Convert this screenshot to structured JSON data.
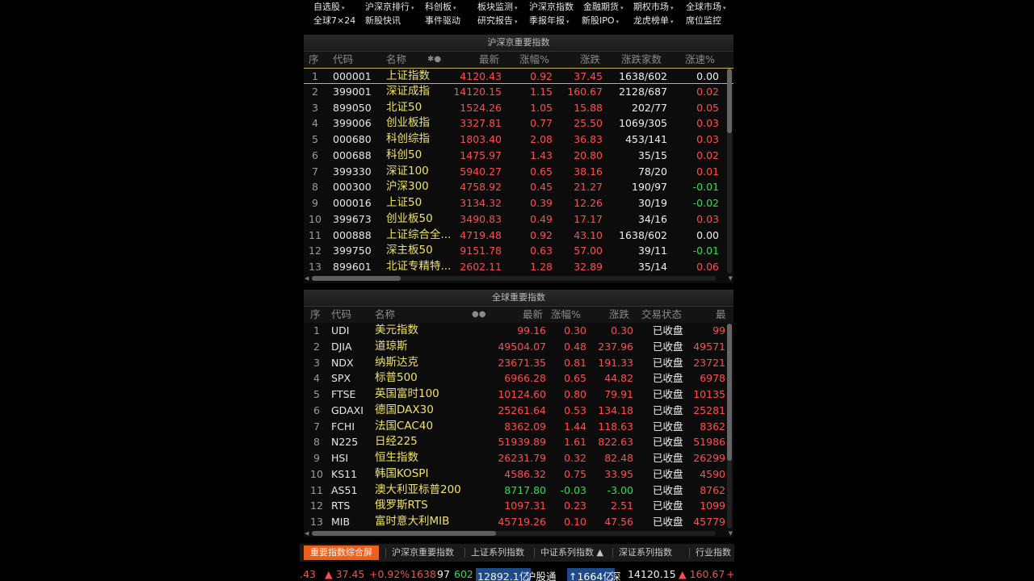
{
  "menu": {
    "row1": [
      {
        "label": "自选股",
        "dd": true
      },
      {
        "label": "沪深京排行",
        "dd": true
      },
      {
        "label": "科创板",
        "dd": true
      },
      {
        "label": "板块监测",
        "dd": true
      },
      {
        "label": "沪深京指数",
        "dd": false
      },
      {
        "label": "金融期货",
        "dd": true
      },
      {
        "label": "期权市场",
        "dd": true
      },
      {
        "label": "全球市场",
        "dd": true
      }
    ],
    "row2": [
      {
        "label": "全球7×24",
        "dd": false
      },
      {
        "label": "新股快讯",
        "dd": false
      },
      {
        "label": "事件驱动",
        "dd": false
      },
      {
        "label": "研究报告",
        "dd": true
      },
      {
        "label": "季报年报",
        "dd": true
      },
      {
        "label": "新股IPO",
        "dd": true
      },
      {
        "label": "龙虎榜单",
        "dd": true
      },
      {
        "label": "席位监控",
        "dd": false
      }
    ]
  },
  "domestic": {
    "title": "沪深京重要指数",
    "headers": {
      "idx": "序",
      "code": "代码",
      "name": "名称",
      "dots": "✱●",
      "last": "最新",
      "pct": "涨幅%",
      "chg": "涨跌",
      "adv": "涨跌家数",
      "speed": "涨速%"
    },
    "rows": [
      {
        "idx": "1",
        "code": "000001",
        "name": "上证指数",
        "last": "4120.43",
        "pct": "0.92",
        "chg": "37.45",
        "adv": "1638/602",
        "speed": "0.00",
        "sc": "white"
      },
      {
        "idx": "2",
        "code": "399001",
        "name": "深证成指",
        "last": "14120.15",
        "pct": "1.15",
        "chg": "160.67",
        "adv": "2128/687",
        "speed": "0.02",
        "sc": "red"
      },
      {
        "idx": "3",
        "code": "899050",
        "name": "北证50",
        "last": "1524.26",
        "pct": "1.05",
        "chg": "15.88",
        "adv": "202/77",
        "speed": "0.05",
        "sc": "red"
      },
      {
        "idx": "4",
        "code": "399006",
        "name": "创业板指",
        "last": "3327.81",
        "pct": "0.77",
        "chg": "25.50",
        "adv": "1069/305",
        "speed": "0.03",
        "sc": "red"
      },
      {
        "idx": "5",
        "code": "000680",
        "name": "科创综指",
        "last": "1803.40",
        "pct": "2.08",
        "chg": "36.83",
        "adv": "453/141",
        "speed": "0.03",
        "sc": "red"
      },
      {
        "idx": "6",
        "code": "000688",
        "name": "科创50",
        "last": "1475.97",
        "pct": "1.43",
        "chg": "20.80",
        "adv": "35/15",
        "speed": "0.02",
        "sc": "red"
      },
      {
        "idx": "7",
        "code": "399330",
        "name": "深证100",
        "last": "5940.27",
        "pct": "0.65",
        "chg": "38.16",
        "adv": "78/20",
        "speed": "0.01",
        "sc": "red"
      },
      {
        "idx": "8",
        "code": "000300",
        "name": "沪深300",
        "last": "4758.92",
        "pct": "0.45",
        "chg": "21.27",
        "adv": "190/97",
        "speed": "-0.01",
        "sc": "green"
      },
      {
        "idx": "9",
        "code": "000016",
        "name": "上证50",
        "last": "3134.32",
        "pct": "0.39",
        "chg": "12.26",
        "adv": "30/19",
        "speed": "-0.02",
        "sc": "green"
      },
      {
        "idx": "10",
        "code": "399673",
        "name": "创业板50",
        "last": "3490.83",
        "pct": "0.49",
        "chg": "17.17",
        "adv": "34/16",
        "speed": "0.03",
        "sc": "red"
      },
      {
        "idx": "11",
        "code": "000888",
        "name": "上证综合全...",
        "last": "4719.48",
        "pct": "0.92",
        "chg": "43.10",
        "adv": "1638/602",
        "speed": "0.00",
        "sc": "white"
      },
      {
        "idx": "12",
        "code": "399750",
        "name": "深主板50",
        "last": "9151.78",
        "pct": "0.63",
        "chg": "57.00",
        "adv": "39/11",
        "speed": "-0.01",
        "sc": "green"
      },
      {
        "idx": "13",
        "code": "899601",
        "name": "北证专精特...",
        "last": "2602.11",
        "pct": "1.28",
        "chg": "32.89",
        "adv": "35/14",
        "speed": "0.06",
        "sc": "red"
      }
    ]
  },
  "global": {
    "title": "全球重要指数",
    "headers": {
      "idx": "序",
      "code": "代码",
      "name": "名称",
      "dots": "●●",
      "last": "最新",
      "pct": "涨幅%",
      "chg": "涨跌",
      "status": "交易状态",
      "extra": "最"
    },
    "rows": [
      {
        "idx": "1",
        "code": "UDI",
        "name": "美元指数",
        "last": "99.16",
        "pct": "0.30",
        "chg": "0.30",
        "status": "已收盘",
        "extra": "99",
        "c": "red"
      },
      {
        "idx": "2",
        "code": "DJIA",
        "name": "道琼斯",
        "last": "49504.07",
        "pct": "0.48",
        "chg": "237.96",
        "status": "已收盘",
        "extra": "49571",
        "c": "red"
      },
      {
        "idx": "3",
        "code": "NDX",
        "name": "纳斯达克",
        "last": "23671.35",
        "pct": "0.81",
        "chg": "191.33",
        "status": "已收盘",
        "extra": "23721",
        "c": "red"
      },
      {
        "idx": "4",
        "code": "SPX",
        "name": "标普500",
        "last": "6966.28",
        "pct": "0.65",
        "chg": "44.82",
        "status": "已收盘",
        "extra": "6978",
        "c": "red"
      },
      {
        "idx": "5",
        "code": "FTSE",
        "name": "英国富时100",
        "last": "10124.60",
        "pct": "0.80",
        "chg": "79.91",
        "status": "已收盘",
        "extra": "10135",
        "c": "red"
      },
      {
        "idx": "6",
        "code": "GDAXI",
        "name": "德国DAX30",
        "last": "25261.64",
        "pct": "0.53",
        "chg": "134.18",
        "status": "已收盘",
        "extra": "25281",
        "c": "red"
      },
      {
        "idx": "7",
        "code": "FCHI",
        "name": "法国CAC40",
        "last": "8362.09",
        "pct": "1.44",
        "chg": "118.63",
        "status": "已收盘",
        "extra": "8362",
        "c": "red"
      },
      {
        "idx": "8",
        "code": "N225",
        "name": "日经225",
        "last": "51939.89",
        "pct": "1.61",
        "chg": "822.63",
        "status": "已收盘",
        "extra": "51986",
        "c": "red"
      },
      {
        "idx": "9",
        "code": "HSI",
        "name": "恒生指数",
        "last": "26231.79",
        "pct": "0.32",
        "chg": "82.48",
        "status": "已收盘",
        "extra": "26299",
        "c": "red"
      },
      {
        "idx": "10",
        "code": "KS11",
        "name": "韩国KOSPI",
        "last": "4586.32",
        "pct": "0.75",
        "chg": "33.95",
        "status": "已收盘",
        "extra": "4590",
        "c": "red"
      },
      {
        "idx": "11",
        "code": "AS51",
        "name": "澳大利亚标普200",
        "last": "8717.80",
        "pct": "-0.03",
        "chg": "-3.00",
        "status": "已收盘",
        "extra": "8762",
        "c": "green"
      },
      {
        "idx": "12",
        "code": "RTS",
        "name": "俄罗斯RTS",
        "last": "1097.31",
        "pct": "0.23",
        "chg": "2.51",
        "status": "已收盘",
        "extra": "1099",
        "c": "red"
      },
      {
        "idx": "13",
        "code": "MIB",
        "name": "富时意大利MIB",
        "last": "45719.26",
        "pct": "0.10",
        "chg": "47.56",
        "status": "已收盘",
        "extra": "45779",
        "c": "red"
      }
    ]
  },
  "tabs": [
    {
      "label": "重要指数综合屏",
      "active": true
    },
    {
      "label": "沪深京重要指数",
      "active": false
    },
    {
      "label": "上证系列指数",
      "active": false
    },
    {
      "label": "中证系列指数 ▲",
      "active": false
    },
    {
      "label": "深证系列指数",
      "active": false
    },
    {
      "label": "行业指数",
      "active": false
    }
  ],
  "ticker": {
    "t0": ".43",
    "t1": "▲ 37.45",
    "t2": "+0.92%",
    "t3": "1638",
    "t4": "97",
    "t5": "602",
    "t6": "12892.1亿",
    "t7": "沪股通",
    "t8": "↑1664亿",
    "t9": "深",
    "t10": "14120.15",
    "t11": "▲ 160.67",
    "t12": "+"
  },
  "colors": {
    "up": "#ff4d4d",
    "down": "#2ee04a",
    "name": "#efe26a",
    "accent": "#e9611c"
  }
}
